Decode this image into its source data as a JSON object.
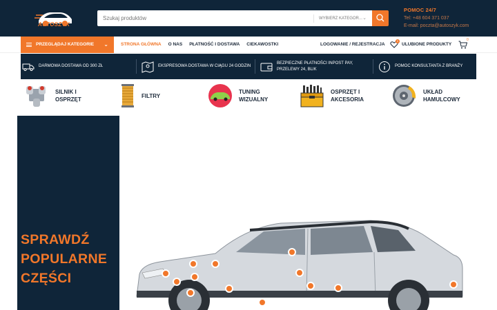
{
  "header": {
    "logo_text": "AUTOSZYK",
    "search": {
      "placeholder": "Szukaj produktów",
      "category_select": "WYBIERZ KATEGOR...",
      "button_icon": "search-icon"
    },
    "help": {
      "title": "POMOC 24/7",
      "phone": "Tel: +48 604 371 037",
      "email": "E-mail: poczta@autoszyk.com"
    }
  },
  "nav": {
    "browse_label": "PRZEGLĄDAJ KATEGORIE",
    "links": [
      {
        "label": "STRONA GŁÓWNA",
        "active": true
      },
      {
        "label": "O NAS",
        "active": false
      },
      {
        "label": "PŁATNOŚĆ I DOSTAWA",
        "active": false
      },
      {
        "label": "CIEKAWOSTKI",
        "active": false
      }
    ],
    "account_label": "LOGOWANIE / REJESTRACJA",
    "wishlist_label": "ULUBIONE PRODUKTY",
    "wishlist_count": "0",
    "cart_count": "0"
  },
  "features": [
    {
      "icon": "truck-icon",
      "text": "DARMOWA DOSTAWA OD 300 ZŁ"
    },
    {
      "icon": "map-icon",
      "text": "EKSPRESOWA DOSTAWA W CIĄGU 24 GODZIN"
    },
    {
      "icon": "wallet-icon",
      "text": "BEZPIECZNE PŁATNOŚCI INPOST PAY, PRZELEWY 24, BLIK"
    },
    {
      "icon": "info-icon",
      "text": "POMOC KONSULTANTA Z BRANŻY"
    }
  ],
  "categories": [
    {
      "icon": "engine-icon",
      "label": "SILNIK I OSPRZĘT"
    },
    {
      "icon": "filter-icon",
      "label": "FILTRY"
    },
    {
      "icon": "car-tuning-icon",
      "label": "TUNING WIZUALNY"
    },
    {
      "icon": "toolbox-icon",
      "label": "OSPRZĘT I AKCESORIA"
    },
    {
      "icon": "brake-icon",
      "label": "UKŁAD HAMULCOWY"
    }
  ],
  "hero": {
    "title_lines": [
      "SPRAWDŹ",
      "POPULARNE",
      "CZĘŚCI"
    ]
  },
  "colors": {
    "navy": "#0f2539",
    "orange": "#f1772a"
  }
}
